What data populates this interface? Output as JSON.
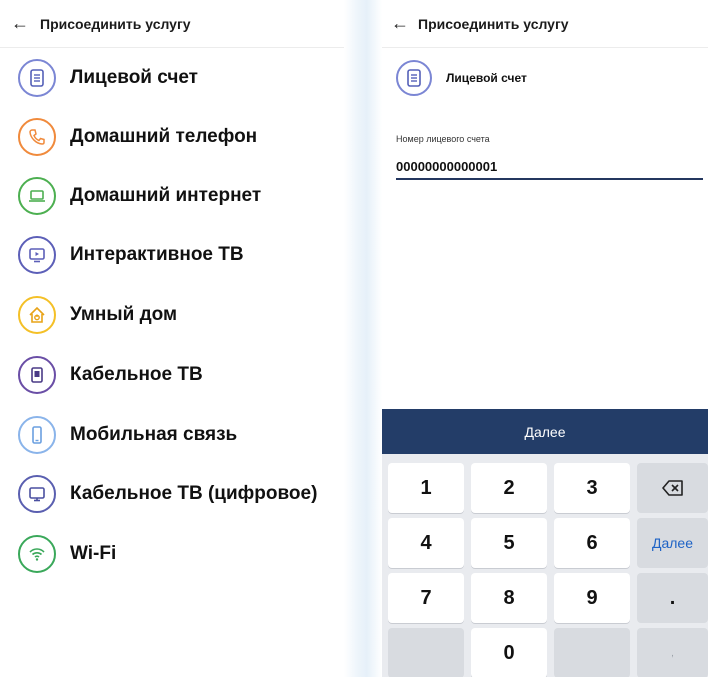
{
  "left_screen": {
    "title": "Присоединить услугу",
    "back_icon": "←",
    "services": [
      {
        "label": "Лицевой счет",
        "icon": "document-icon",
        "color": "#7b86d4"
      },
      {
        "label": "Домашний телефон",
        "icon": "phone-icon",
        "color": "#f08a3c"
      },
      {
        "label": "Домашний интернет",
        "icon": "laptop-icon",
        "color": "#4caf50"
      },
      {
        "label": "Интерактивное ТВ",
        "icon": "tv-play-icon",
        "color": "#5c5fb8"
      },
      {
        "label": "Умный дом",
        "icon": "smart-home-icon",
        "color": "#f4c027"
      },
      {
        "label": "Кабельное ТВ",
        "icon": "cable-tv-icon",
        "color": "#6a4ea6"
      },
      {
        "label": "Мобильная связь",
        "icon": "mobile-icon",
        "color": "#8ab4ea"
      },
      {
        "label": "Кабельное ТВ (цифровое)",
        "icon": "monitor-icon",
        "color": "#5a5fb0"
      },
      {
        "label": "Wi-Fi",
        "icon": "wifi-icon",
        "color": "#3aa85a"
      }
    ]
  },
  "right_screen": {
    "title": "Присоединить услугу",
    "back_icon": "←",
    "selected_service": "Лицевой счет",
    "field_label": "Номер лицевого счета",
    "field_value": "00000000000001",
    "next_button": "Далее",
    "keyboard": {
      "row1": [
        "1",
        "2",
        "3"
      ],
      "row2": [
        "4",
        "5",
        "6"
      ],
      "row3": [
        "7",
        "8",
        "9"
      ],
      "row4": [
        "0"
      ],
      "action_key": "Далее",
      "period_key": ".",
      "comma_key": ","
    }
  },
  "colors": {
    "primary_dark": "#233d68",
    "action_blue": "#1e63c6",
    "keyboard_bg": "#e9ebef"
  }
}
